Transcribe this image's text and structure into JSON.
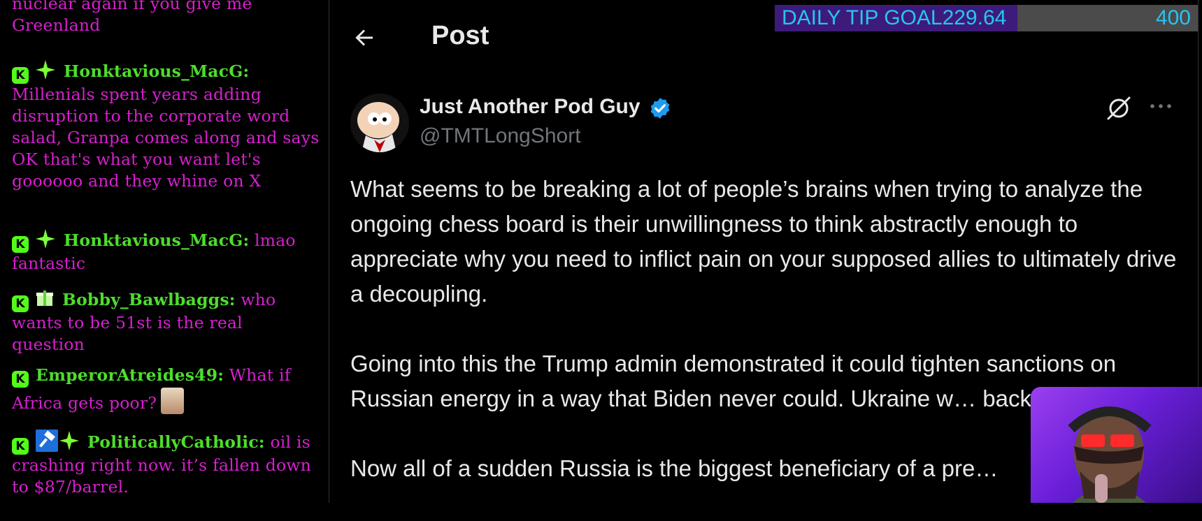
{
  "chat": {
    "messages": [
      {
        "user": "",
        "text": "nuclear again if you give me Greenland"
      },
      {
        "user": "Honktavious_MacG:",
        "text": "Millenials spent years adding disruption to the corporate word salad, Granpa comes along and says OK that's what you want let's goooooo and they whine on X"
      },
      {
        "user": "Honktavious_MacG:",
        "text": "lmao fantastic"
      },
      {
        "user": "Bobby_Bawlbaggs:",
        "text": "who wants to be 51st is the real question"
      },
      {
        "user": "EmperorAtreides49:",
        "text": "What if Africa gets poor?"
      },
      {
        "user": "PoliticallyCatholic:",
        "text": "oil is crashing right now. it’s fallen down to $87/barrel."
      }
    ],
    "badge_letter": "K"
  },
  "post": {
    "header_title": "Post",
    "author": {
      "display_name": "Just Another Pod Guy",
      "handle": "@TMTLongShort"
    },
    "paragraphs": [
      "What seems to be breaking a lot of people’s brains when trying to analyze the ongoing chess board is their unwillingness to think abstractly enough to appreciate why you need to inflict pain on your supposed allies to ultimately drive a decoupling.",
      "Going into this the Trump admin demonstrated it could tighten sanctions on Russian energy in a way that Biden never could.  Ukraine w… back territory.",
      "Now all of a sudden Russia is the biggest beneficiary of a pre…"
    ]
  },
  "tip_goal": {
    "label": "DAILY TIP GOAL",
    "current": "229.64",
    "max": "400",
    "progress_fraction": 0.574
  },
  "colors": {
    "chat_text": "#d81fd0",
    "chat_user": "#4dde2c",
    "kick_green": "#53fc18",
    "x_text": "#e7e9ea",
    "x_muted": "#71767b",
    "verified_blue": "#1d9bf0",
    "tip_text": "#25c6f3",
    "tip_fill": "#3d1b7a"
  },
  "icons": {
    "back": "arrow-left-icon",
    "verified": "verified-badge-icon",
    "grok": "grok-icon",
    "more": "more-horizontal-icon",
    "sparkle": "sparkle-icon",
    "gift": "gift-icon",
    "gavel": "gavel-icon"
  }
}
